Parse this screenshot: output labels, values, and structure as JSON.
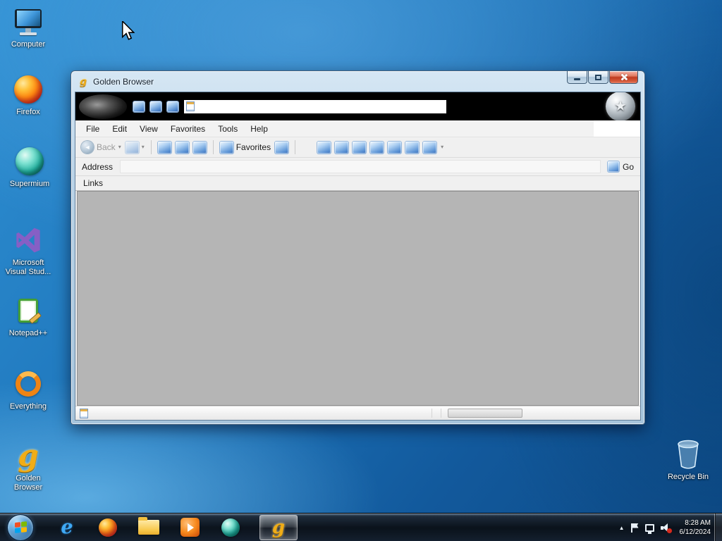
{
  "desktop": {
    "icons": [
      {
        "label": "Computer"
      },
      {
        "label": "Firefox"
      },
      {
        "label": "Supermium"
      },
      {
        "label": "Microsoft Visual Stud..."
      },
      {
        "label": "Notepad++"
      },
      {
        "label": "Everything"
      },
      {
        "label": "Golden Browser"
      },
      {
        "label": "Recycle Bin"
      }
    ]
  },
  "window": {
    "title": "Golden Browser",
    "menu": {
      "items": [
        {
          "label": "File"
        },
        {
          "label": "Edit"
        },
        {
          "label": "View"
        },
        {
          "label": "Favorites"
        },
        {
          "label": "Tools"
        },
        {
          "label": "Help"
        }
      ]
    },
    "toolbar": {
      "back_label": "Back",
      "favorites_label": "Favorites"
    },
    "band": {
      "input_value": ""
    },
    "address": {
      "label": "Address",
      "value": "",
      "go_label": "Go"
    },
    "links": {
      "label": "Links"
    }
  },
  "taskbar": {
    "clock": {
      "time": "8:28 AM",
      "date": "6/12/2024"
    }
  },
  "glyphs": {
    "dropdown": "▾",
    "back_arrow": "◄",
    "star": "★",
    "chevron_up": "▲",
    "golden_g": "g",
    "ie_e": "e"
  },
  "colors": {
    "desktop_blue": "#1d74ba",
    "window_frame": "#b9d2e6",
    "close_red": "#c03a20",
    "gold": "#f0ad17",
    "content_gray": "#b5b5b5",
    "taskbar_dark": "#0a1018"
  }
}
